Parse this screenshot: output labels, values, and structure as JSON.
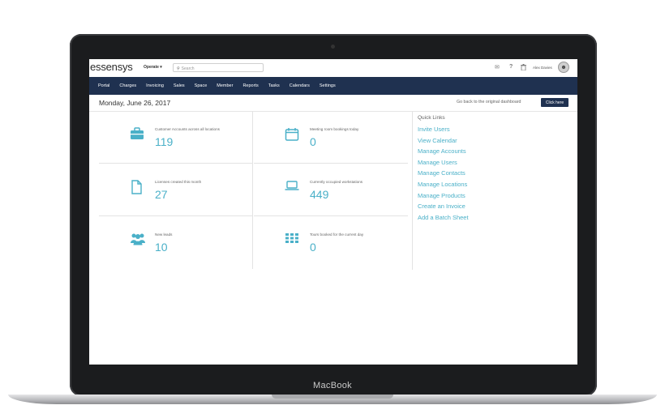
{
  "device": {
    "label": "MacBook"
  },
  "app": {
    "logo": "essensys",
    "operate_label": "Operate ▾",
    "search_placeholder": "Search",
    "user_name": "Alex Davies"
  },
  "icons": {
    "mail": "envelope-icon",
    "help": "question-icon",
    "trash": "trash-icon",
    "search": "search-icon"
  },
  "nav": [
    {
      "label": "Portal"
    },
    {
      "label": "Charges"
    },
    {
      "label": "Invoicing"
    },
    {
      "label": "Sales"
    },
    {
      "label": "Space"
    },
    {
      "label": "Member"
    },
    {
      "label": "Reports"
    },
    {
      "label": "Tasks"
    },
    {
      "label": "Calendars"
    },
    {
      "label": "Settings"
    }
  ],
  "header": {
    "date": "Monday, June 26, 2017",
    "go_back_text": "Go back to the original dashboard",
    "click_here_label": "Click here"
  },
  "stats": [
    {
      "label": "Customer Accounts across all locations",
      "value": "119",
      "icon": "briefcase-icon"
    },
    {
      "label": "Meeting room bookings today",
      "value": "0",
      "icon": "calendar-icon"
    },
    {
      "label": "Licenses created this month",
      "value": "27",
      "icon": "document-icon"
    },
    {
      "label": "Currently occupied workstations",
      "value": "449",
      "icon": "laptop-icon"
    },
    {
      "label": "New leads",
      "value": "10",
      "icon": "group-icon"
    },
    {
      "label": "Tours booked for the current day",
      "value": "0",
      "icon": "grid-icon"
    }
  ],
  "quick_links": {
    "title": "Quick Links",
    "items": [
      {
        "label": "Invite Users"
      },
      {
        "label": "View Calendar"
      },
      {
        "label": "Manage Accounts"
      },
      {
        "label": "Manage Users"
      },
      {
        "label": "Manage Contacts"
      },
      {
        "label": "Manage Locations"
      },
      {
        "label": "Manage Products"
      },
      {
        "label": "Create an Invoice"
      },
      {
        "label": "Add a Batch Sheet"
      }
    ]
  },
  "colors": {
    "nav_bg": "#1f3150",
    "accent": "#4ab0c8",
    "button_bg": "#1f3150"
  }
}
